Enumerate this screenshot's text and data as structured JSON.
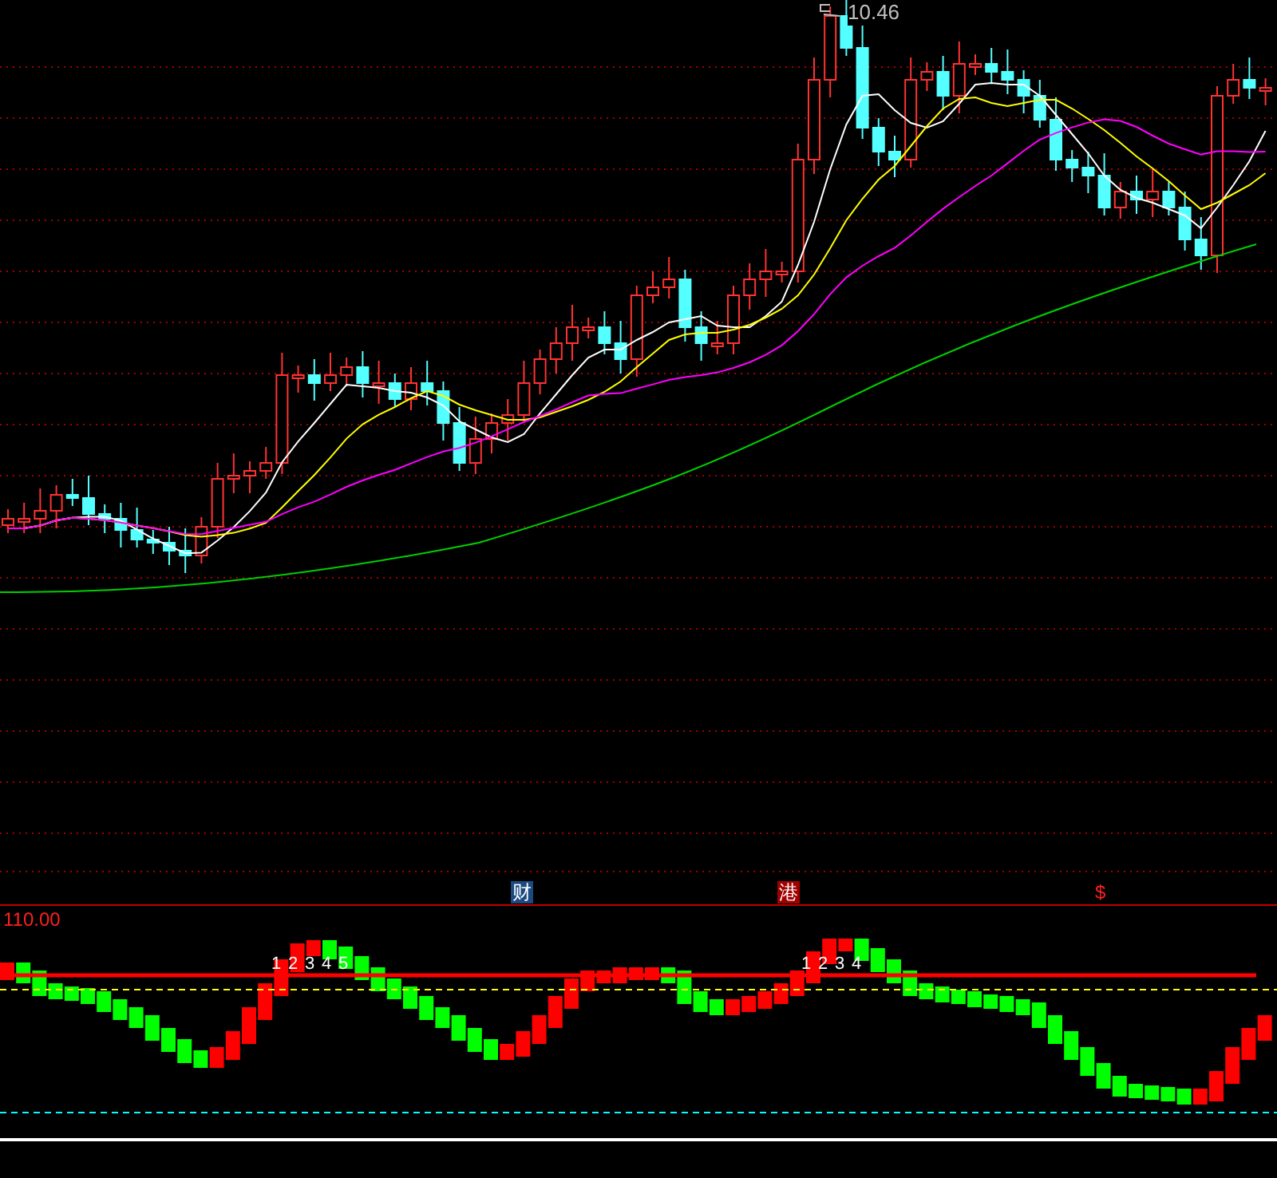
{
  "main_chart": {
    "max_price_label": "10.46"
  },
  "event_markers": [
    {
      "kind": "finance",
      "label": "财"
    },
    {
      "kind": "hk",
      "label": "港"
    },
    {
      "kind": "dollar",
      "label": "$"
    }
  ],
  "indicator": {
    "value_label": "110.00",
    "counters": [
      {
        "digits": [
          "1",
          "2",
          "3",
          "4",
          "5"
        ]
      },
      {
        "digits": [
          "1",
          "2",
          "3",
          "4"
        ]
      }
    ]
  }
}
